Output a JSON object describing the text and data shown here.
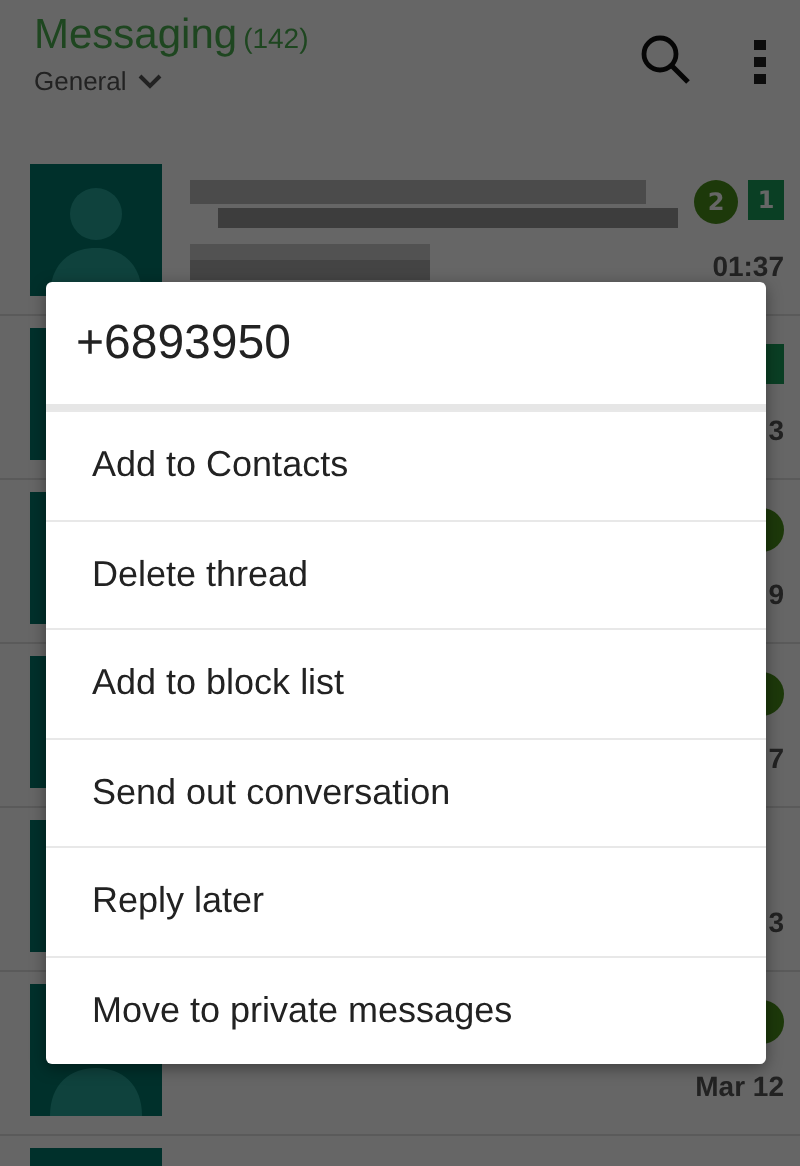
{
  "header": {
    "title": "Messaging",
    "count": "(142)",
    "folder": "General"
  },
  "threads": [
    {
      "kind": "blurred",
      "time": "01:37",
      "markers": [
        {
          "kind": "dot",
          "text": "2"
        },
        {
          "kind": "square",
          "text": "1"
        }
      ]
    },
    {
      "kind": "covered",
      "time": "3",
      "markers": [
        {
          "kind": "square"
        }
      ]
    },
    {
      "kind": "covered",
      "time": "9",
      "markers": [
        {
          "kind": "dot"
        }
      ]
    },
    {
      "kind": "covered",
      "time": "7",
      "markers": [
        {
          "kind": "dot"
        }
      ]
    },
    {
      "kind": "covered",
      "time": "3"
    },
    {
      "kind": "covered",
      "time": "Mar 12",
      "markers": [
        {
          "kind": "dot"
        }
      ]
    },
    {
      "kind": "covered"
    }
  ],
  "menu": {
    "title": "+6893950",
    "items": [
      "Add to Contacts",
      "Delete thread",
      "Add to block list",
      "Send out conversation",
      "Reply later",
      "Move to private messages"
    ]
  }
}
